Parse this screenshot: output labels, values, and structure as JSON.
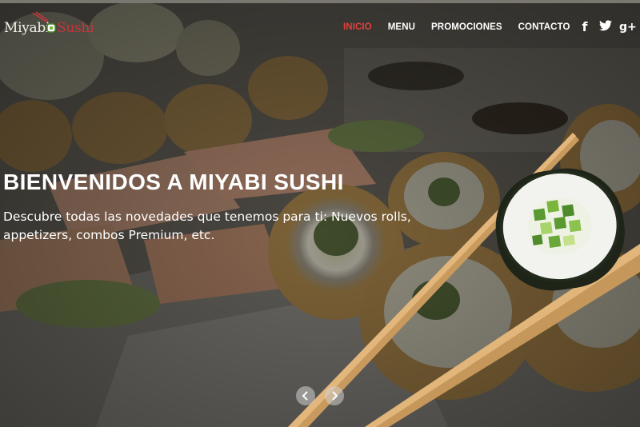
{
  "brand": {
    "part1": "Miyabi",
    "part2": "Sushi"
  },
  "nav": {
    "items": [
      {
        "label": "INICIO",
        "active": true
      },
      {
        "label": "MENU",
        "active": false
      },
      {
        "label": "PROMOCIONES",
        "active": false
      },
      {
        "label": "CONTACTO",
        "active": false
      }
    ]
  },
  "social": {
    "facebook": "f",
    "twitter": "🐦",
    "googleplus": "g+"
  },
  "hero": {
    "title": "BIENVENIDOS A MIYABI SUSHI",
    "subtitle": "Descubre todas las novedades que tenemos para ti: Nuevos rolls, appetizers, combos Premium, etc."
  },
  "carousel": {
    "prev_icon": "chevron-left",
    "next_icon": "chevron-right"
  },
  "colors": {
    "accent": "#e0403c",
    "overlay": "#2b2926",
    "text": "#ffffff"
  }
}
